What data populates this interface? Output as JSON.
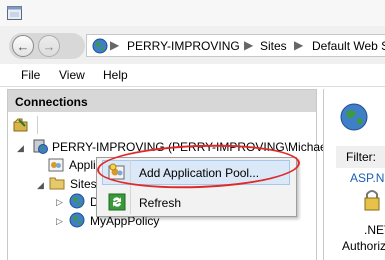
{
  "address_bar": {
    "crumbs": [
      "PERRY-IMPROVING",
      "Sites",
      "Default Web Site"
    ],
    "separator": "▶"
  },
  "menu": [
    "File",
    "View",
    "Help"
  ],
  "connections": {
    "title": "Connections",
    "tree": {
      "server": "PERRY-IMPROVING (PERRY-IMPROVING\\Michael)",
      "app_pools": "Application Pools",
      "sites": "Sites",
      "default_site": "Default Web Site",
      "my_app_policy": "MyAppPolicy"
    }
  },
  "right_panel": {
    "filter_label": "Filter:",
    "item_asp": "ASP.N",
    "item_net": ".NET",
    "item_authorization": "Authoriz"
  },
  "context_menu": {
    "items": [
      "Add Application Pool...",
      "Refresh"
    ]
  }
}
